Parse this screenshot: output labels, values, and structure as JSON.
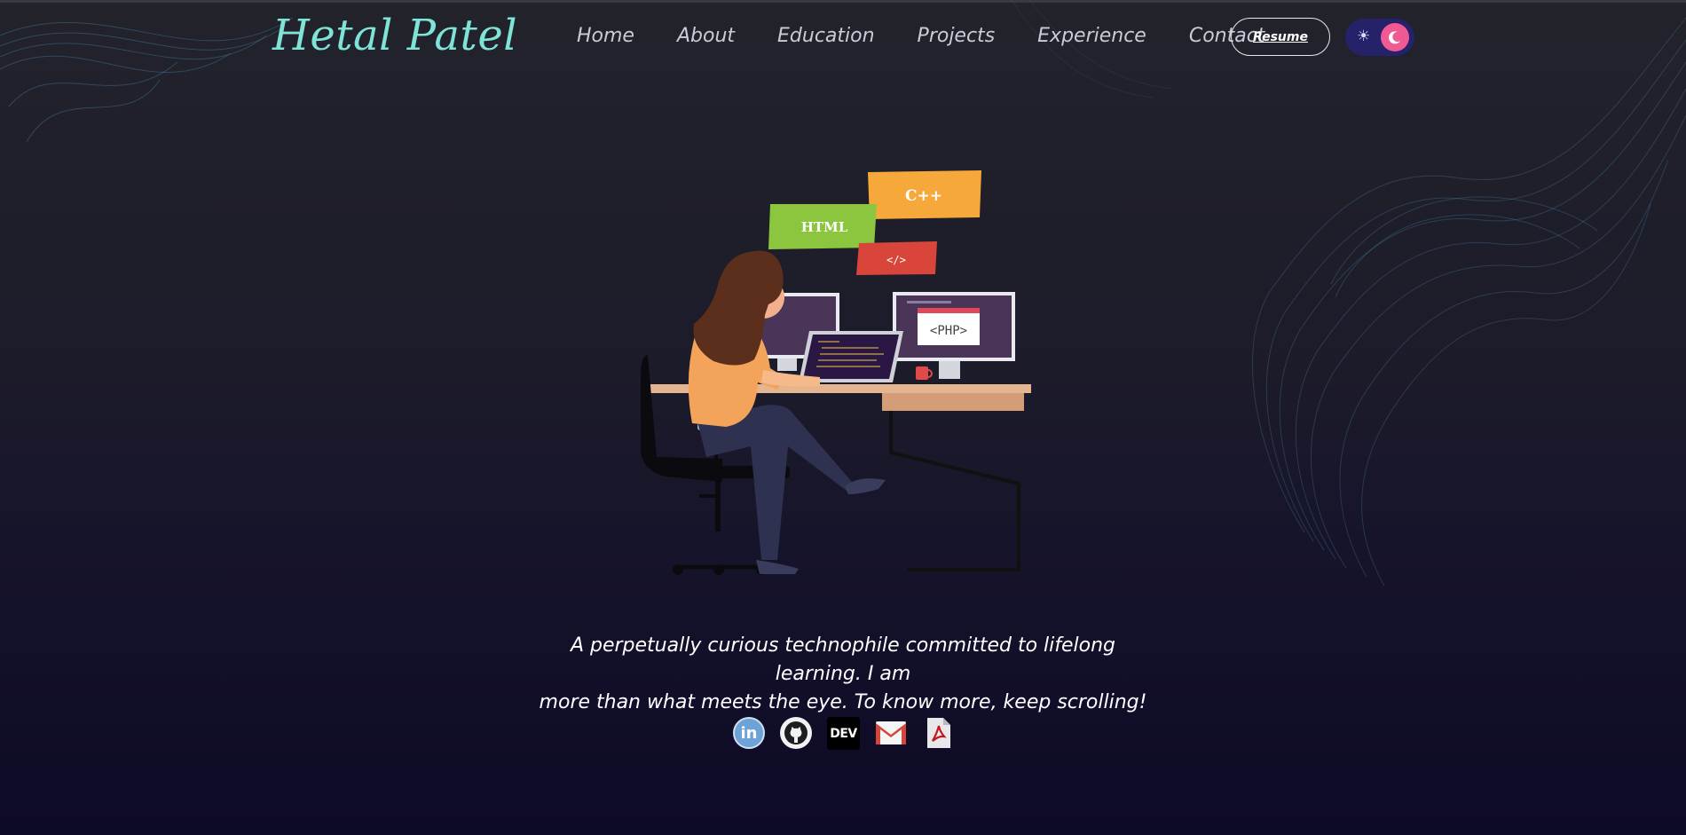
{
  "header": {
    "logo": "Hetal Patel",
    "nav": [
      "Home",
      "About",
      "Education",
      "Projects",
      "Experience",
      "Contact"
    ],
    "resume_label": "Resume",
    "theme_toggle": {
      "sun_icon": "☀",
      "state": "dark"
    }
  },
  "hero": {
    "illustration_tags": {
      "cpp": "C++",
      "html": "HTML",
      "code": "</>",
      "php": "<PHP>"
    },
    "tagline_line1": "A perpetually curious technophile committed to lifelong learning. I am",
    "tagline_line2": "more than what meets the eye. To know more, keep scrolling!"
  },
  "socials": {
    "linkedin_label": "in",
    "dev_label": "DEV"
  },
  "colors": {
    "logo": "#7fe3d8",
    "toggle_bg": "#25226a",
    "toggle_knob": "#f05a94",
    "wave": "#5aa9d6"
  }
}
